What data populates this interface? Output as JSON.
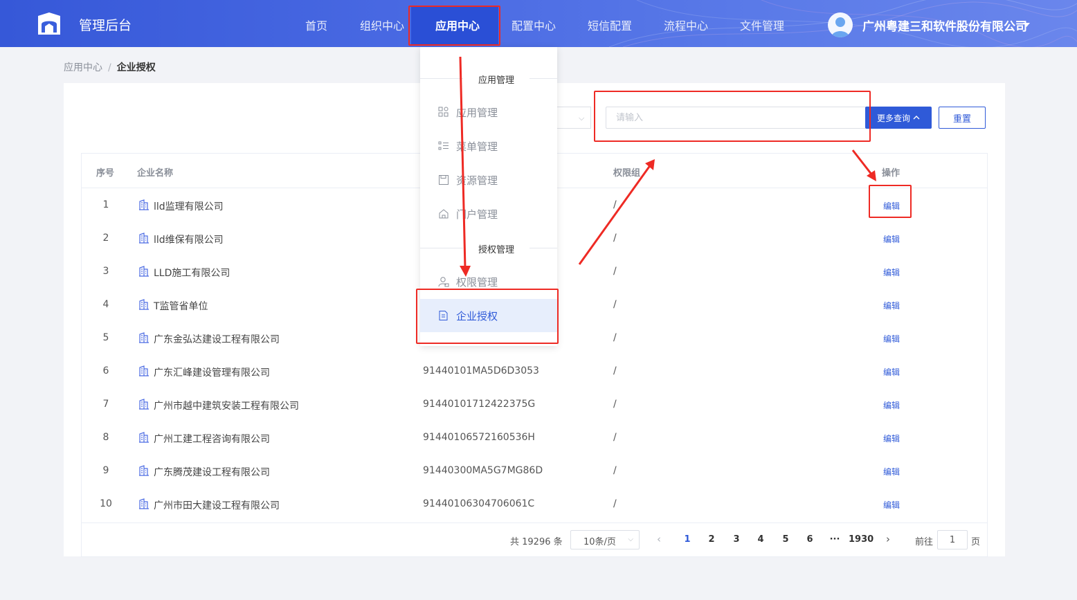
{
  "header": {
    "app_title": "管理后台",
    "nav": [
      {
        "label": "首页"
      },
      {
        "label": "组织中心"
      },
      {
        "label": "应用中心",
        "active": true
      },
      {
        "label": "配置中心"
      },
      {
        "label": "短信配置"
      },
      {
        "label": "流程中心"
      },
      {
        "label": "文件管理"
      }
    ],
    "company": "广州粤建三和软件股份有限公司"
  },
  "breadcrumb": {
    "parent": "应用中心",
    "separator": "/",
    "current": "企业授权"
  },
  "search": {
    "placeholder": "请输入",
    "more_label": "更多查询",
    "reset_label": "重置"
  },
  "table": {
    "headers": {
      "index": "序号",
      "name": "企业名称",
      "permission": "权限组",
      "action": "操作"
    },
    "edit_label": "编辑",
    "rows": [
      {
        "idx": "1",
        "name": "lld监理有限公司",
        "code": "",
        "perm": "/"
      },
      {
        "idx": "2",
        "name": "lld维保有限公司",
        "code": "",
        "perm": "/"
      },
      {
        "idx": "3",
        "name": "LLD施工有限公司",
        "code": "",
        "perm": "/"
      },
      {
        "idx": "4",
        "name": "T监管省单位",
        "code": "",
        "perm": "/"
      },
      {
        "idx": "5",
        "name": "广东金弘达建设工程有限公司",
        "code": "",
        "perm": "/"
      },
      {
        "idx": "6",
        "name": "广东汇峰建设管理有限公司",
        "code": "91440101MA5D6D3053",
        "perm": "/"
      },
      {
        "idx": "7",
        "name": "广州市越中建筑安装工程有限公司",
        "code": "91440101712422375G",
        "perm": "/"
      },
      {
        "idx": "8",
        "name": "广州工建工程咨询有限公司",
        "code": "91440106572160536H",
        "perm": "/"
      },
      {
        "idx": "9",
        "name": "广东腾茂建设工程有限公司",
        "code": "91440300MA5G7MG86D",
        "perm": "/"
      },
      {
        "idx": "10",
        "name": "广州市田大建设工程有限公司",
        "code": "91440106304706061C",
        "perm": "/"
      }
    ]
  },
  "pagination": {
    "total": "共 19296 条",
    "page_size": "10条/页",
    "pages": [
      "1",
      "2",
      "3",
      "4",
      "5",
      "6"
    ],
    "ellipsis": "···",
    "last": "1930",
    "current": "1",
    "goto_prefix": "前往",
    "goto_value": "1",
    "goto_suffix": "页"
  },
  "dropdown": {
    "group1": "应用管理",
    "group2": "授权管理",
    "items": [
      {
        "label": "应用管理",
        "icon": "apps-icon"
      },
      {
        "label": "菜单管理",
        "icon": "menu-list-icon"
      },
      {
        "label": "资源管理",
        "icon": "save-icon"
      },
      {
        "label": "门户管理",
        "icon": "home-icon"
      },
      {
        "label": "权限管理",
        "icon": "user-lock-icon"
      },
      {
        "label": "企业授权",
        "icon": "document-icon",
        "active": true
      }
    ]
  },
  "colors": {
    "primary": "#2f5ad8",
    "header": "#3658d8",
    "annotation": "#ee2a24"
  }
}
